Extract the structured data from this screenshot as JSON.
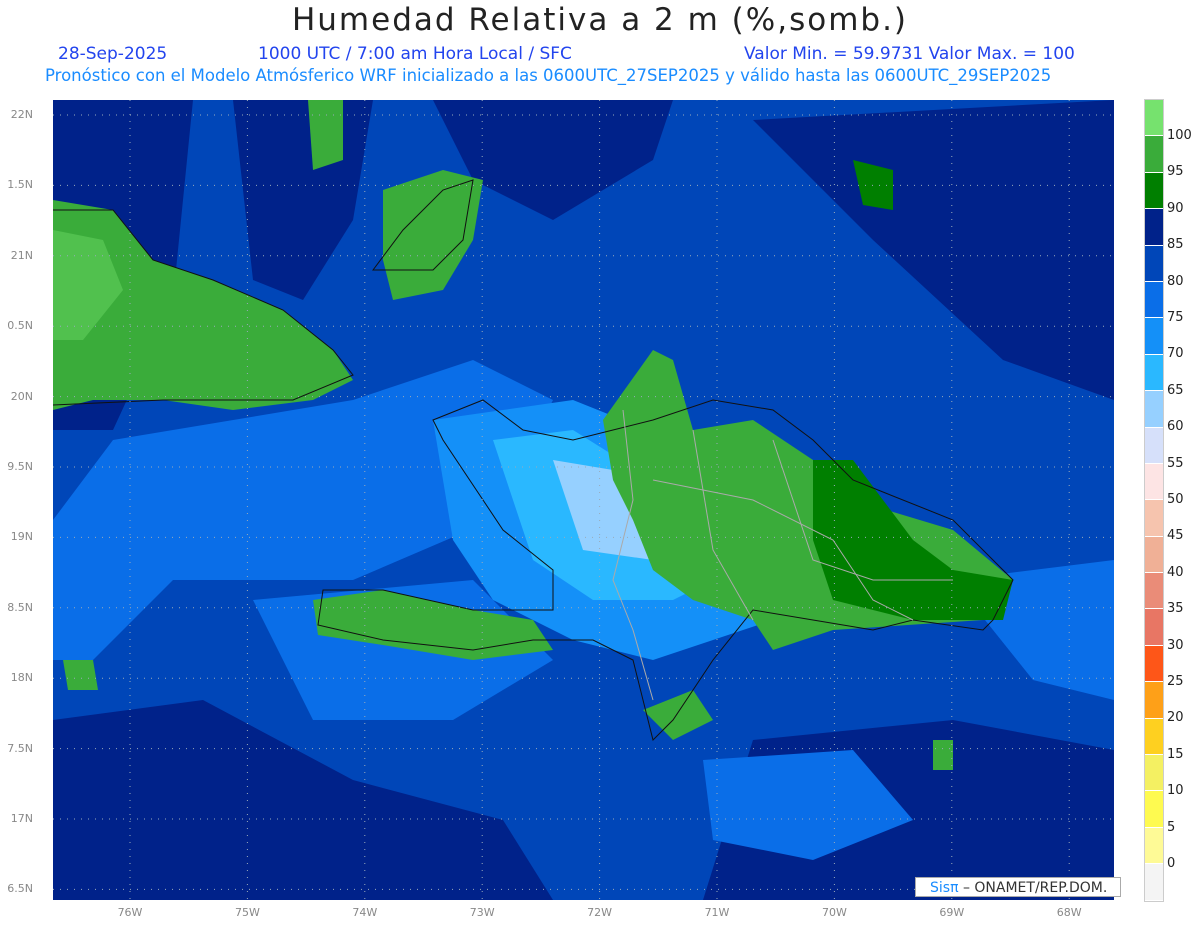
{
  "title": "Humedad Relativa a 2 m (%,somb.)",
  "date": "28-Sep-2025",
  "time": "1000 UTC / 7:00 am Hora Local / SFC",
  "minmax": "Valor Min. = 59.9731  Valor Max. = 100",
  "subtitle": "Pronóstico con el Modelo Atmósferico WRF inicializado a las 0600UTC_27SEP2025 y válido hasta las  0600UTC_29SEP2025",
  "lat_labels": [
    "22N",
    "1.5N",
    "21N",
    "0.5N",
    "20N",
    "9.5N",
    "19N",
    "8.5N",
    "18N",
    "7.5N",
    "17N",
    "6.5N"
  ],
  "lon_labels": [
    "76W",
    "75W",
    "74W",
    "73W",
    "72W",
    "71W",
    "70W",
    "69W",
    "68W"
  ],
  "colorbar": {
    "labels": [
      "100",
      "95",
      "90",
      "85",
      "80",
      "75",
      "70",
      "65",
      "60",
      "55",
      "50",
      "45",
      "40",
      "35",
      "30",
      "25",
      "20",
      "15",
      "10",
      "5",
      "0"
    ],
    "colors": [
      "#76e26e",
      "#3aac3a",
      "#007f00",
      "#00228a",
      "#0046b8",
      "#0a6ee8",
      "#1490f8",
      "#2ab8ff",
      "#96d0ff",
      "#d6e0fa",
      "#fde4e4",
      "#f6c4ae",
      "#f0b096",
      "#ea8c78",
      "#e87664",
      "#fe5618",
      "#fea018",
      "#fed020",
      "#f4f062",
      "#fefa50",
      "#fefa96",
      "#f4f4f4"
    ]
  },
  "credit": {
    "logo": "Sisπ",
    "text": "– ONAMET/REP.DOM."
  }
}
